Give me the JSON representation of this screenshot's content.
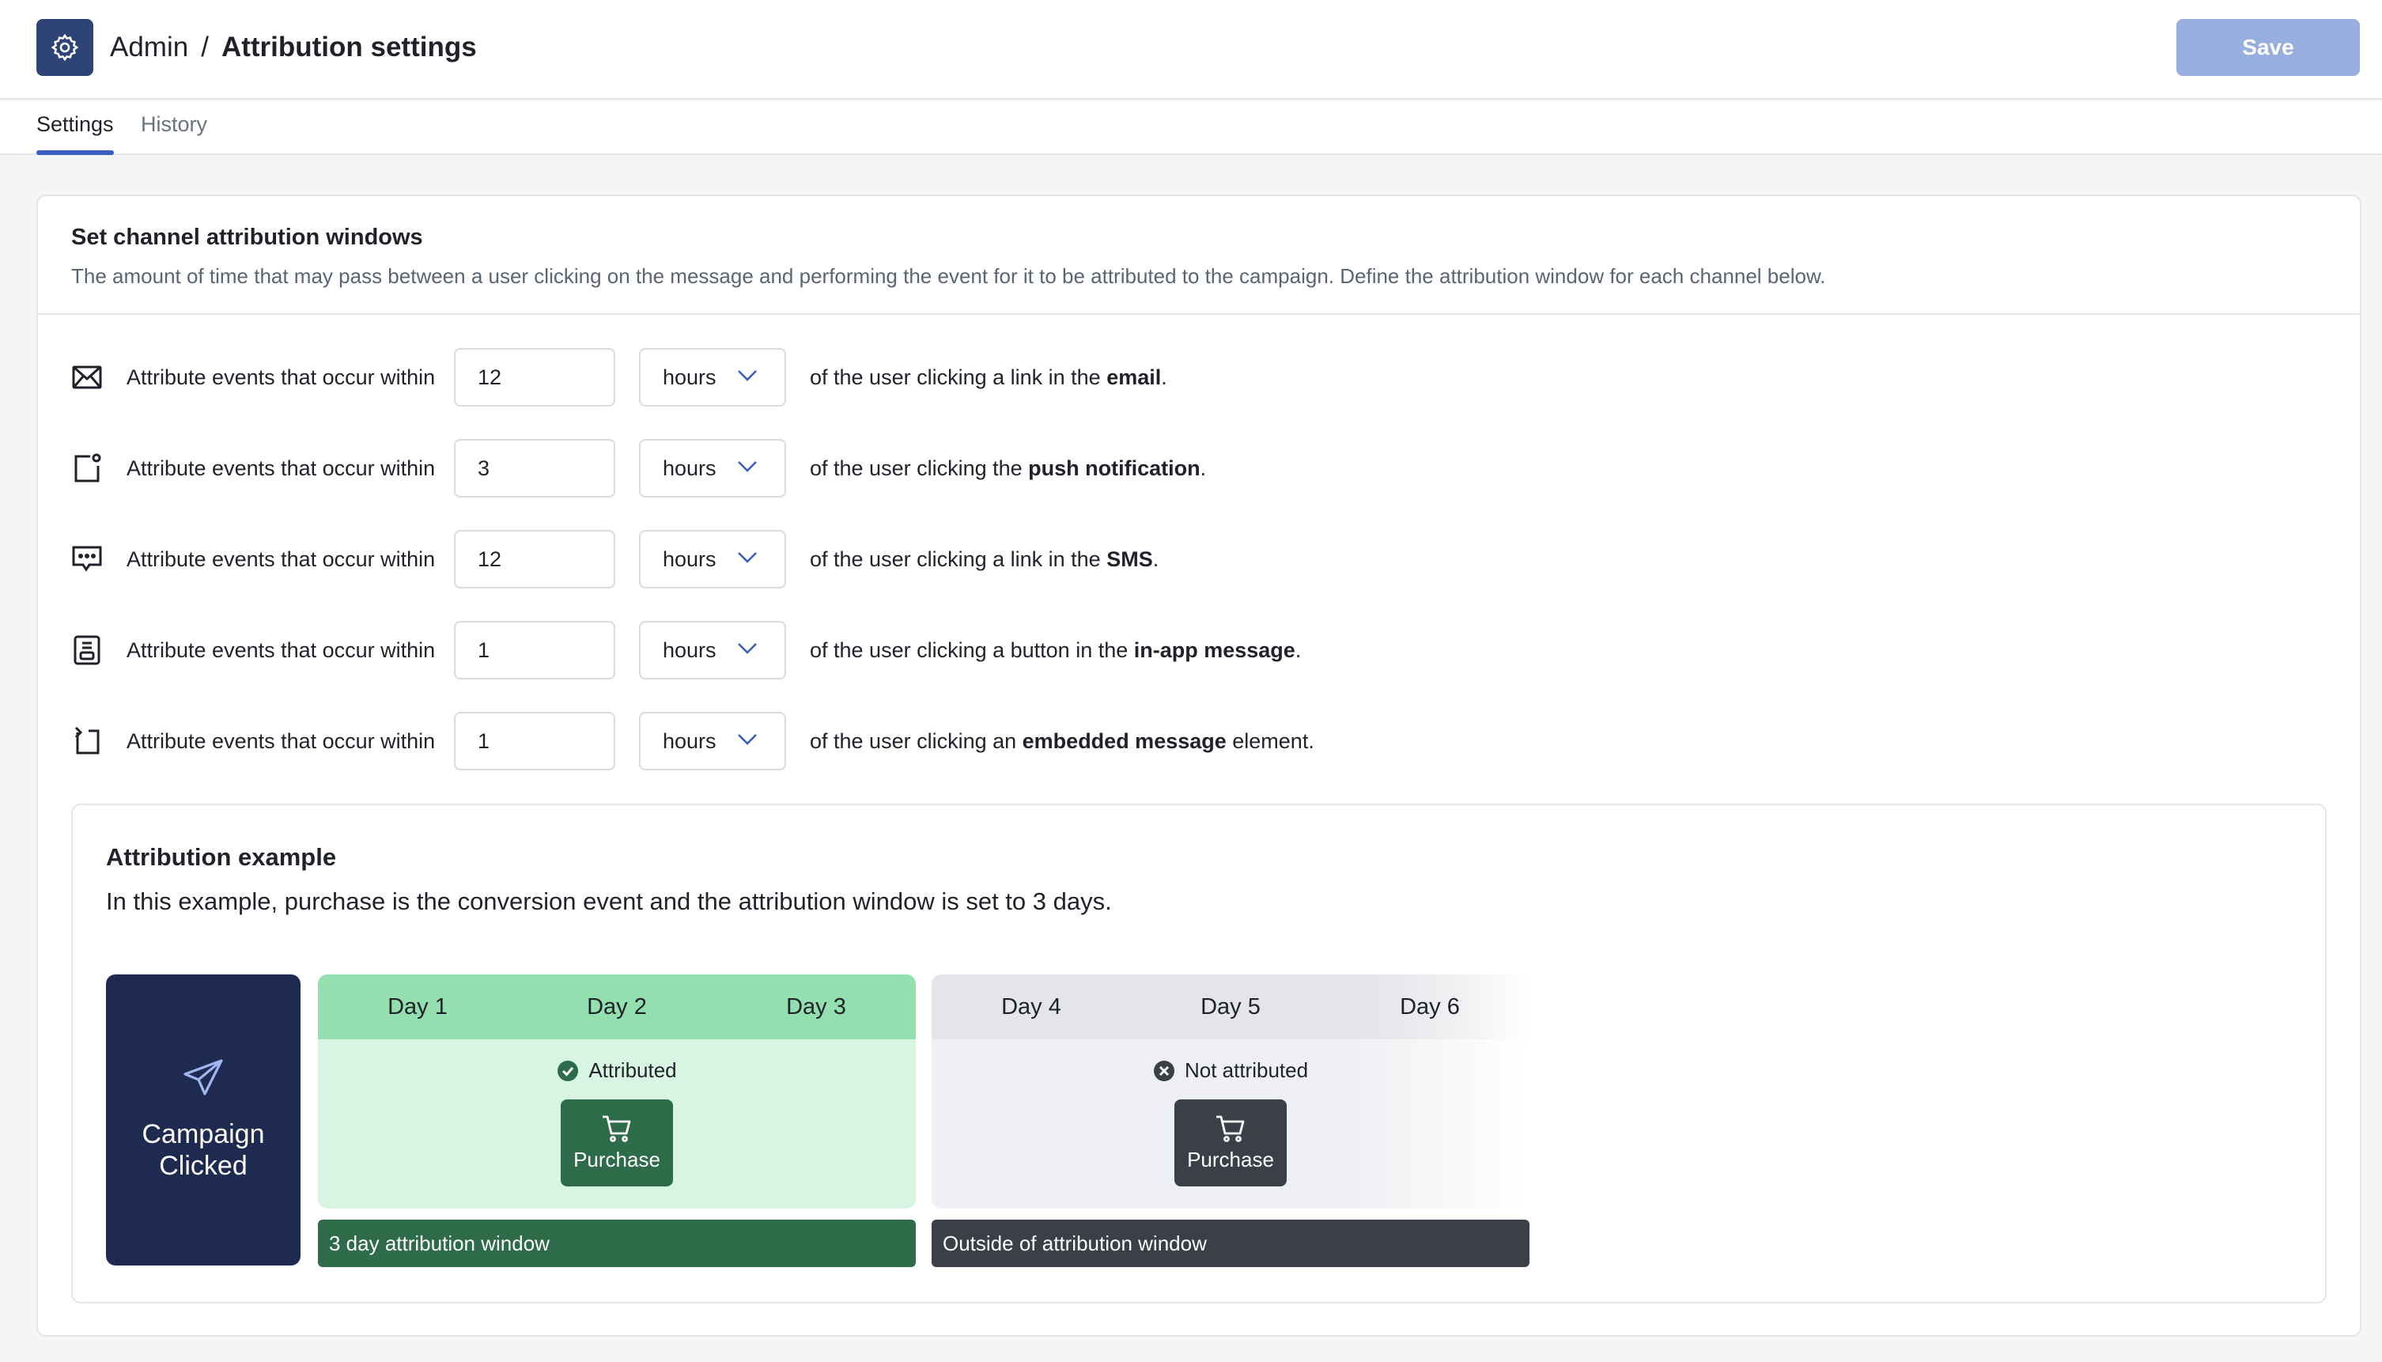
{
  "header": {
    "logo_icon": "gear-icon",
    "breadcrumb_root": "Admin",
    "breadcrumb_sep": "/",
    "breadcrumb_current": "Attribution settings",
    "save_label": "Save"
  },
  "tabs": [
    {
      "label": "Settings",
      "active": true
    },
    {
      "label": "History",
      "active": false
    }
  ],
  "section": {
    "title": "Set channel attribution windows",
    "description": "The amount of time that may pass between a user clicking on the message and performing the event for it to be attributed to the campaign. Define the attribution window for each channel below."
  },
  "rows": [
    {
      "icon": "email-icon",
      "label": "Attribute events that occur within",
      "value": "12",
      "unit": "hours",
      "suffix_pre": "of the user clicking a link in the ",
      "suffix_bold": "email",
      "suffix_post": "."
    },
    {
      "icon": "push-notification-icon",
      "label": "Attribute events that occur within",
      "value": "3",
      "unit": "hours",
      "suffix_pre": "of the user clicking the ",
      "suffix_bold": "push notification",
      "suffix_post": "."
    },
    {
      "icon": "sms-icon",
      "label": "Attribute events that occur within",
      "value": "12",
      "unit": "hours",
      "suffix_pre": "of the user clicking a link in the ",
      "suffix_bold": "SMS",
      "suffix_post": "."
    },
    {
      "icon": "in-app-message-icon",
      "label": "Attribute events that occur within",
      "value": "1",
      "unit": "hours",
      "suffix_pre": "of the user clicking a button in the ",
      "suffix_bold": "in-app message",
      "suffix_post": "."
    },
    {
      "icon": "embedded-message-icon",
      "label": "Attribute events that occur within",
      "value": "1",
      "unit": "hours",
      "suffix_pre": "of the user clicking an ",
      "suffix_bold": "embedded message",
      "suffix_post": " element."
    }
  ],
  "example": {
    "title": "Attribution example",
    "description": "In this example, purchase is the conversion event and the attribution window is set to 3 days.",
    "clicked_label": "Campaign Clicked",
    "attributed_days": [
      "Day 1",
      "Day 2",
      "Day 3"
    ],
    "outside_days": [
      "Day 4",
      "Day 5",
      "Day 6"
    ],
    "attributed_status": "Attributed",
    "not_attributed_status": "Not attributed",
    "purchase_label": "Purchase",
    "attributed_window_label": "3 day attribution window",
    "outside_window_label": "Outside of attribution window"
  },
  "colors": {
    "brand": "#2f4476",
    "accent": "#3a5ec0",
    "save_disabled": "#98aedf",
    "attributed_dark": "#2e6b49",
    "attributed_light": "#d8f5e3",
    "not_attributed_dark": "#3a3f48"
  }
}
